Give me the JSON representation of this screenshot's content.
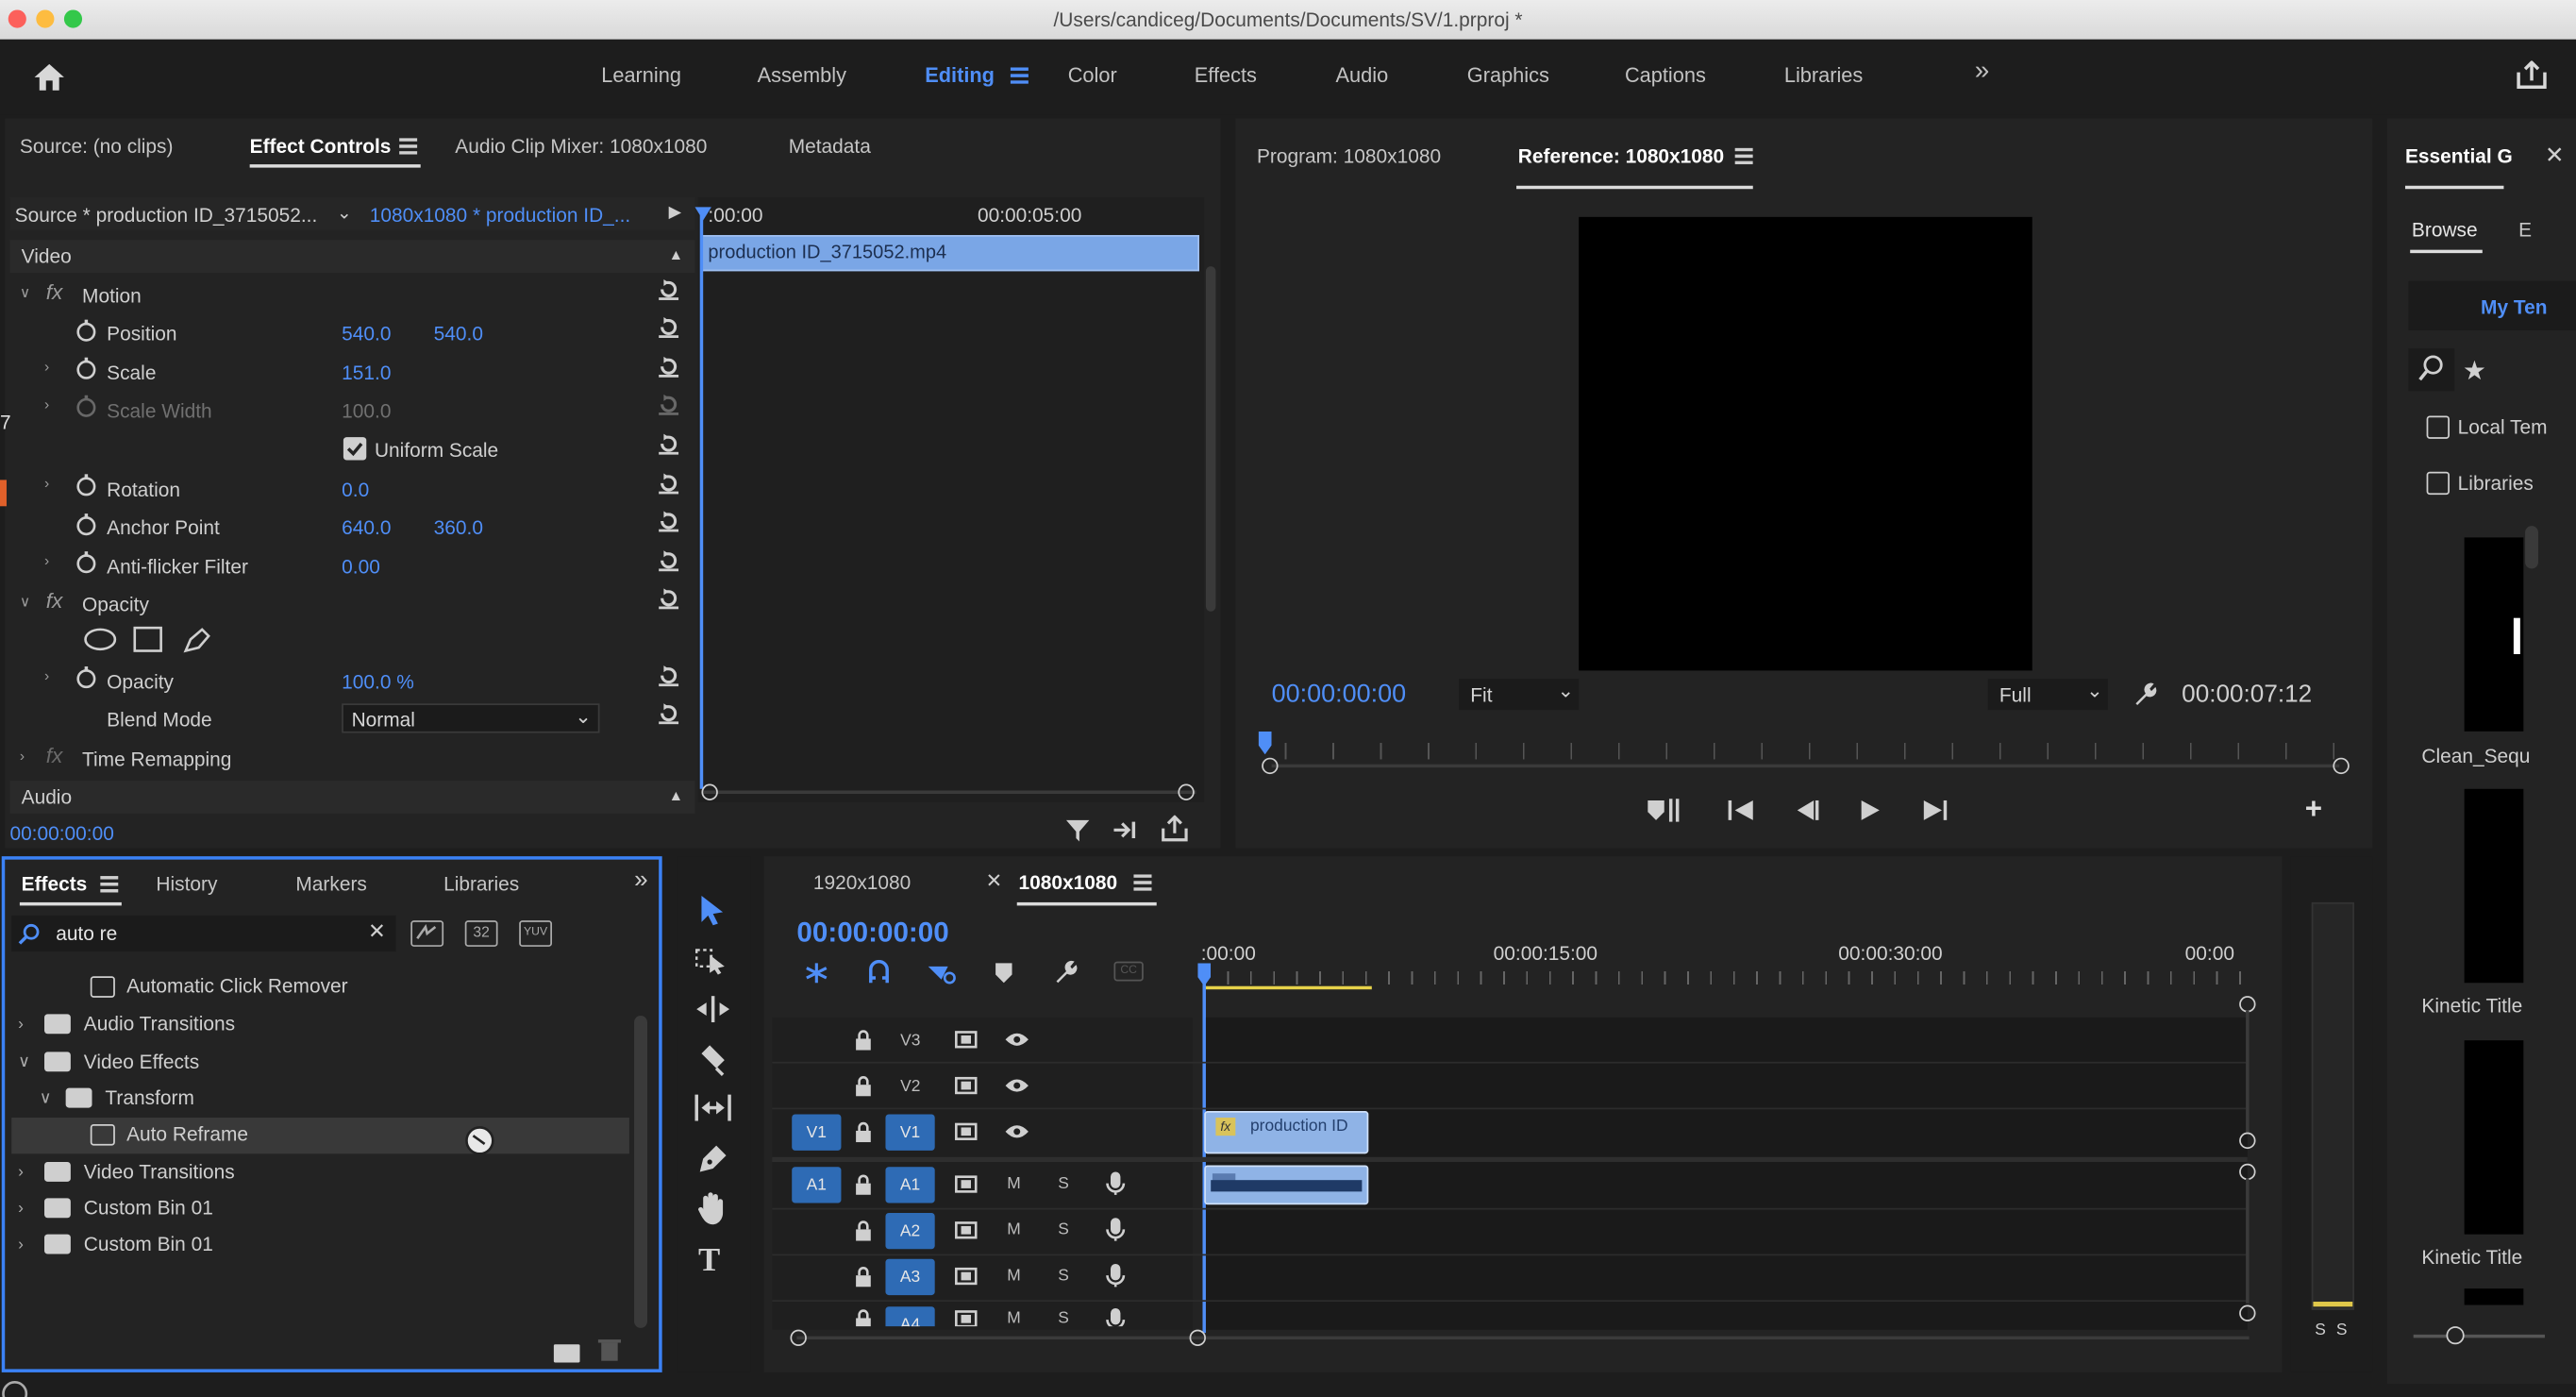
{
  "titlebar": {
    "path": "/Users/candiceg/Documents/Documents/SV/1.prproj *"
  },
  "workspaces": {
    "items": [
      "Learning",
      "Assembly",
      "Editing",
      "Color",
      "Effects",
      "Audio",
      "Graphics",
      "Captions",
      "Libraries"
    ],
    "active": "Editing",
    "overflow": "»"
  },
  "source_panel": {
    "tabs": [
      "Source: (no clips)",
      "Effect Controls",
      "Audio Clip Mixer: 1080x1080",
      "Metadata"
    ],
    "active_tab": "Effect Controls",
    "source_selector": "Source * production ID_3715052...",
    "sequence_selector": "1080x1080 * production ID_...",
    "section_video": "Video",
    "section_audio": "Audio",
    "motion": {
      "label": "Motion",
      "position": {
        "label": "Position",
        "x": "540.0",
        "y": "540.0"
      },
      "scale": {
        "label": "Scale",
        "value": "151.0"
      },
      "scale_width": {
        "label": "Scale Width",
        "value": "100.0"
      },
      "uniform_scale": "Uniform Scale",
      "rotation": {
        "label": "Rotation",
        "value": "0.0"
      },
      "anchor_point": {
        "label": "Anchor Point",
        "x": "640.0",
        "y": "360.0"
      },
      "anti_flicker": {
        "label": "Anti-flicker Filter",
        "value": "0.00"
      }
    },
    "opacity": {
      "label": "Opacity",
      "opacity_prop": {
        "label": "Opacity",
        "value": "100.0 %"
      },
      "blend_mode": {
        "label": "Blend Mode",
        "value": "Normal"
      }
    },
    "time_remapping": "Time Remapping",
    "timecode": "00:00:00:00",
    "mini_timeline": {
      "start": ":00:00",
      "mid": "00:00:05:00",
      "clip": "production ID_3715052.mp4"
    }
  },
  "program_panel": {
    "tabs": [
      "Program: 1080x1080",
      "Reference: 1080x1080"
    ],
    "active_tab": "Reference: 1080x1080",
    "timecode": "00:00:00:00",
    "fit": "Fit",
    "full": "Full",
    "duration": "00:00:07:12"
  },
  "essential_panel": {
    "title": "Essential G",
    "tabs": [
      "Browse",
      "E"
    ],
    "my_templates": "My Ten",
    "local_templates": "Local Tem",
    "libraries": "Libraries",
    "templates": [
      "Clean_Sequ",
      "Kinetic Title",
      "Kinetic Title"
    ]
  },
  "effects_panel": {
    "tabs": [
      "Effects",
      "History",
      "Markers",
      "Libraries"
    ],
    "active_tab": "Effects",
    "search_value": "auto re",
    "tree": [
      {
        "label": "Automatic Click Remover",
        "type": "effect",
        "indent": 2
      },
      {
        "label": "Audio Transitions",
        "type": "folder",
        "indent": 0
      },
      {
        "label": "Video Effects",
        "type": "folder",
        "indent": 0
      },
      {
        "label": "Transform",
        "type": "folder",
        "indent": 1
      },
      {
        "label": "Auto Reframe",
        "type": "effect",
        "indent": 2
      },
      {
        "label": "Video Transitions",
        "type": "folder",
        "indent": 0
      },
      {
        "label": "Custom Bin 01",
        "type": "folder",
        "indent": 0
      },
      {
        "label": "Custom Bin 01",
        "type": "folder",
        "indent": 0
      }
    ],
    "badge_32": "32",
    "badge_yuv": "YUV"
  },
  "timeline_panel": {
    "tabs": [
      "1920x1080",
      "1080x1080"
    ],
    "active_tab": "1080x1080",
    "timecode": "00:00:00:00",
    "ruler": [
      ":00:00",
      "00:00:15:00",
      "00:00:30:00",
      "00:00"
    ],
    "video_tracks": [
      "V3",
      "V2",
      "V1"
    ],
    "audio_tracks": [
      "A1",
      "A2",
      "A3",
      "A4"
    ],
    "src_v1": "V1",
    "src_a1": "A1",
    "clip_label": "production ID",
    "cc": "CC",
    "mute": "M",
    "solo": "S"
  },
  "meter": {
    "labels": [
      "S",
      "S"
    ]
  }
}
